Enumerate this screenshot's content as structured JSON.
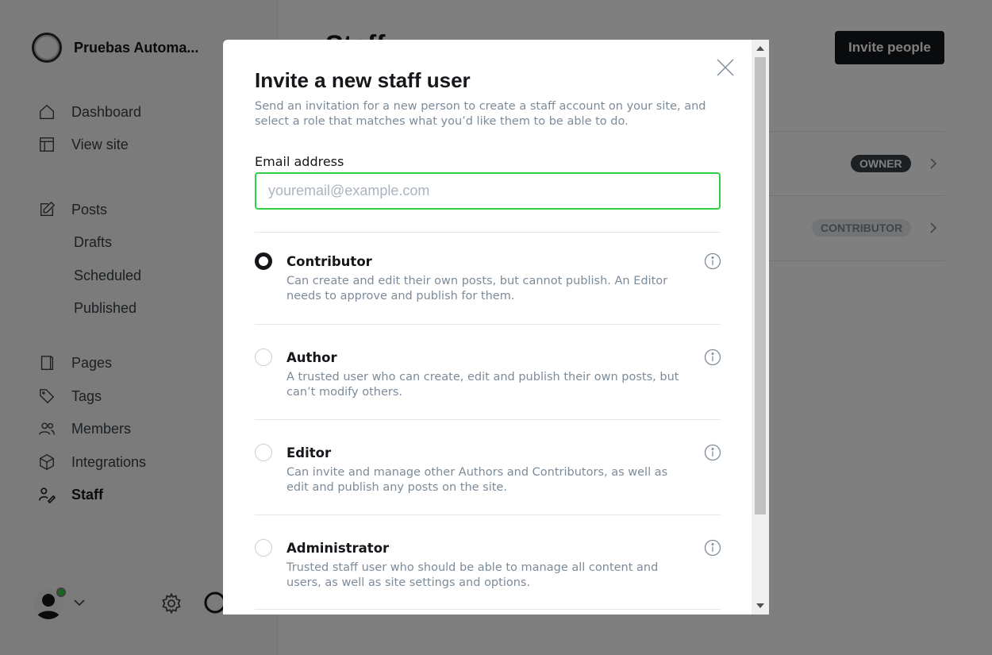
{
  "app": {
    "site_name": "Pruebas Automa...",
    "page_title": "Staff",
    "invite_button": "Invite people"
  },
  "sidebar": {
    "items": [
      {
        "label": "Dashboard",
        "icon": "home-icon"
      },
      {
        "label": "View site",
        "icon": "layout-icon"
      },
      {
        "label": "Posts",
        "icon": "edit-icon"
      },
      {
        "label": "Drafts"
      },
      {
        "label": "Scheduled"
      },
      {
        "label": "Published"
      },
      {
        "label": "Pages",
        "icon": "page-icon"
      },
      {
        "label": "Tags",
        "icon": "tag-icon"
      },
      {
        "label": "Members",
        "icon": "members-icon"
      },
      {
        "label": "Integrations",
        "icon": "cube-icon"
      },
      {
        "label": "Staff",
        "icon": "staff-icon",
        "active": true
      }
    ]
  },
  "staff_list": {
    "rows": [
      {
        "role_badge": "OWNER"
      },
      {
        "role_badge": "CONTRIBUTOR"
      }
    ]
  },
  "modal": {
    "title": "Invite a new staff user",
    "description": "Send an invitation for a new person to create a staff account on your site, and select a role that matches what you’d like them to be able to do.",
    "email_label": "Email address",
    "email_placeholder": "youremail@example.com",
    "email_value": "",
    "roles": [
      {
        "name": "Contributor",
        "description": "Can create and edit their own posts, but cannot publish. An Editor needs to approve and publish for them.",
        "selected": true
      },
      {
        "name": "Author",
        "description": "A trusted user who can create, edit and publish their own posts, but can’t modify others.",
        "selected": false
      },
      {
        "name": "Editor",
        "description": "Can invite and manage other Authors and Contributors, as well as edit and publish any posts on the site.",
        "selected": false
      },
      {
        "name": "Administrator",
        "description": "Trusted staff user who should be able to manage all content and users, as well as site settings and options.",
        "selected": false
      }
    ]
  },
  "colors": {
    "accent_green": "#30cf43",
    "text_dark": "#15171a",
    "text_muted": "#7c8b9a"
  }
}
